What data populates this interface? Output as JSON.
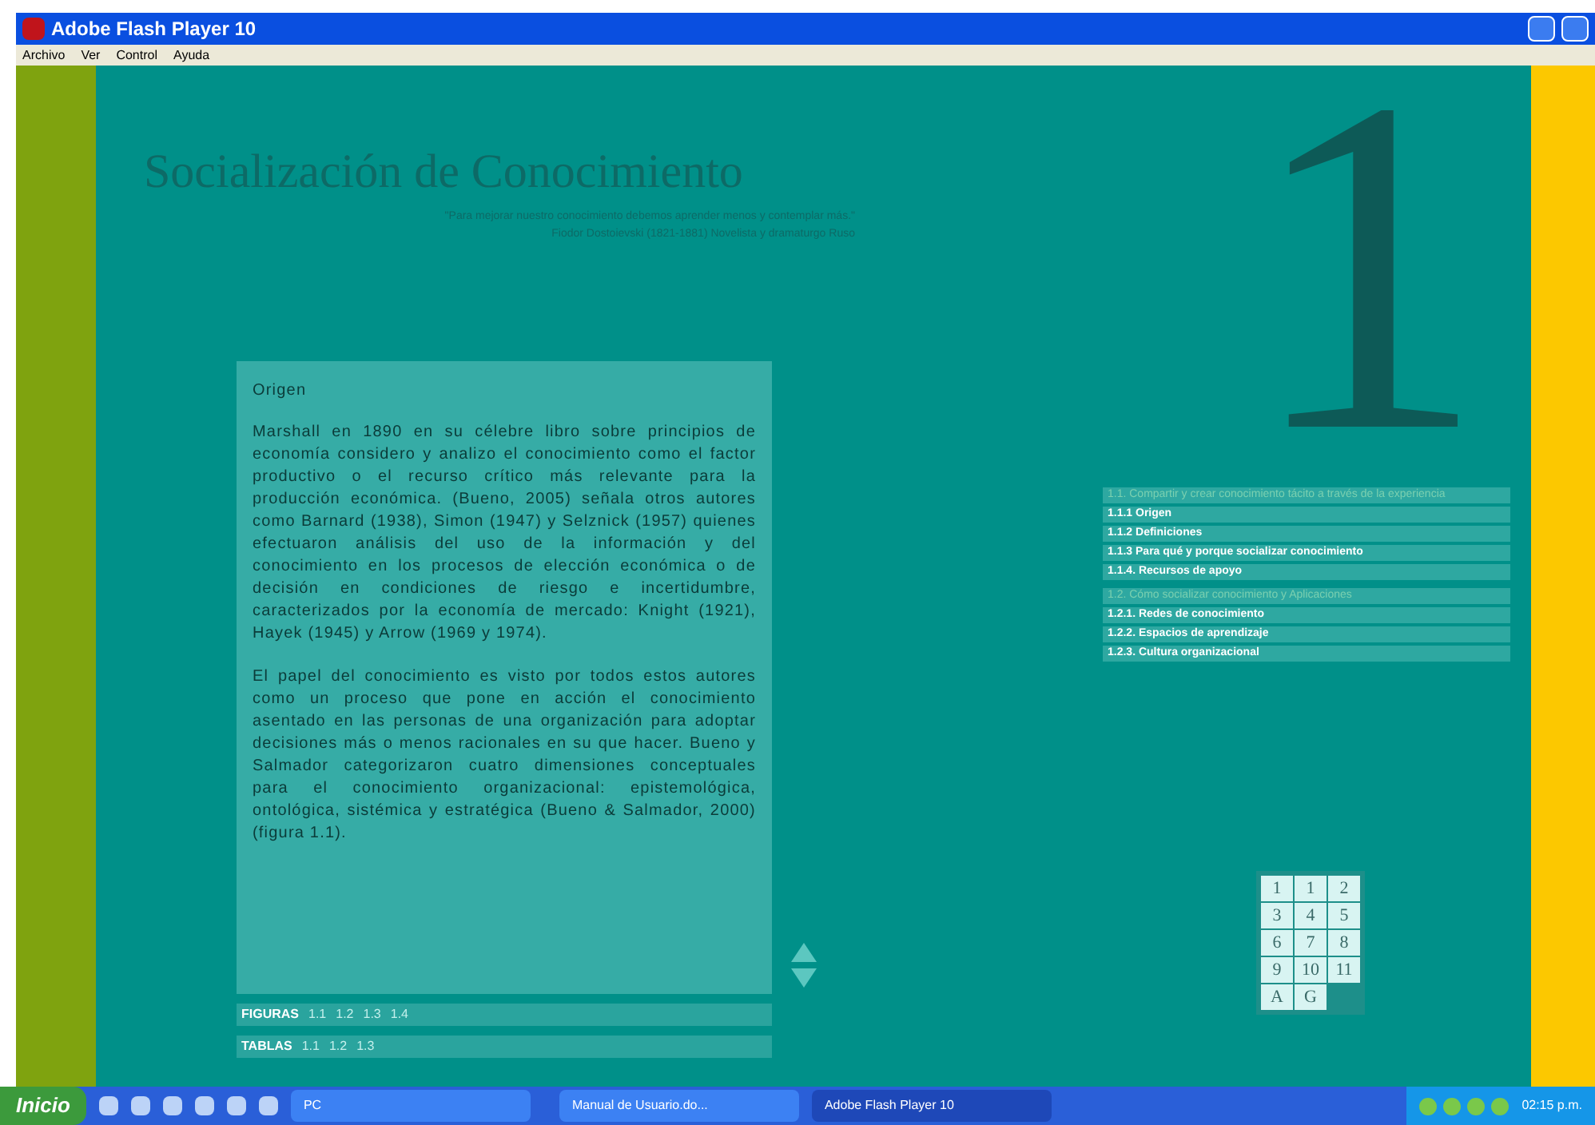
{
  "window": {
    "title": "Adobe Flash Player 10"
  },
  "menu": [
    "Archivo",
    "Ver",
    "Control",
    "Ayuda"
  ],
  "header": {
    "title": "Socialización de Conocimiento",
    "quote": "\"Para mejorar nuestro conocimiento debemos aprender menos y contemplar más.\"",
    "author": "Fiodor Dostoievski (1821-1881) Novelista y dramaturgo Ruso",
    "chapter": "1"
  },
  "article": {
    "heading": "Origen",
    "paragraphs": [
      "Marshall en 1890 en su célebre libro sobre principios de economía considero y analizo el conocimiento como el factor productivo o el recurso crítico más relevante para la producción económica. (Bueno, 2005) señala otros autores como Barnard (1938), Simon (1947) y Selznick (1957) quienes efectuaron análisis del uso de la información y del conocimiento en los procesos de elección económica o de decisión en condiciones de riesgo e incertidumbre, caracterizados por la economía de mercado: Knight (1921), Hayek (1945) y Arrow (1969 y 1974).",
      "El papel del conocimiento es visto por todos estos autores como un proceso que pone en acción el conocimiento asentado en las personas de una organización para adoptar decisiones más o menos racionales en su que hacer. Bueno y Salmador categorizaron cuatro dimensiones conceptuales para el conocimiento organizacional: epistemológica, ontológica, sistémica y estratégica (Bueno & Salmador, 2000) (figura 1.1)."
    ]
  },
  "figures": {
    "label": "FIGURAS",
    "items": [
      "1.1",
      "1.2",
      "1.3",
      "1.4"
    ]
  },
  "tables": {
    "label": "TABLAS",
    "items": [
      "1.1",
      "1.2",
      "1.3"
    ]
  },
  "sections": [
    {
      "title": "1.1. Compartir y crear conocimiento tácito a través de la experiencia",
      "items": [
        "1.1.1 Origen",
        "1.1.2 Definiciones",
        "1.1.3 Para qué y porque socializar conocimiento",
        "1.1.4. Recursos de apoyo"
      ]
    },
    {
      "title": "1.2. Cómo socializar conocimiento y Aplicaciones",
      "items": [
        "1.2.1. Redes de conocimiento",
        "1.2.2. Espacios de aprendizaje",
        "1.2.3. Cultura organizacional"
      ]
    }
  ],
  "chapters": [
    "1",
    "1",
    "2",
    "3",
    "4",
    "5",
    "6",
    "7",
    "8",
    "9",
    "10",
    "11",
    "A",
    "G"
  ],
  "taskbar": {
    "start": "Inicio",
    "windows": [
      {
        "label": "PC",
        "selected": false
      },
      {
        "label": "Manual de Usuario.do...",
        "selected": false
      },
      {
        "label": "Adobe Flash Player 10",
        "selected": true
      }
    ],
    "clock": "02:15 p.m."
  }
}
